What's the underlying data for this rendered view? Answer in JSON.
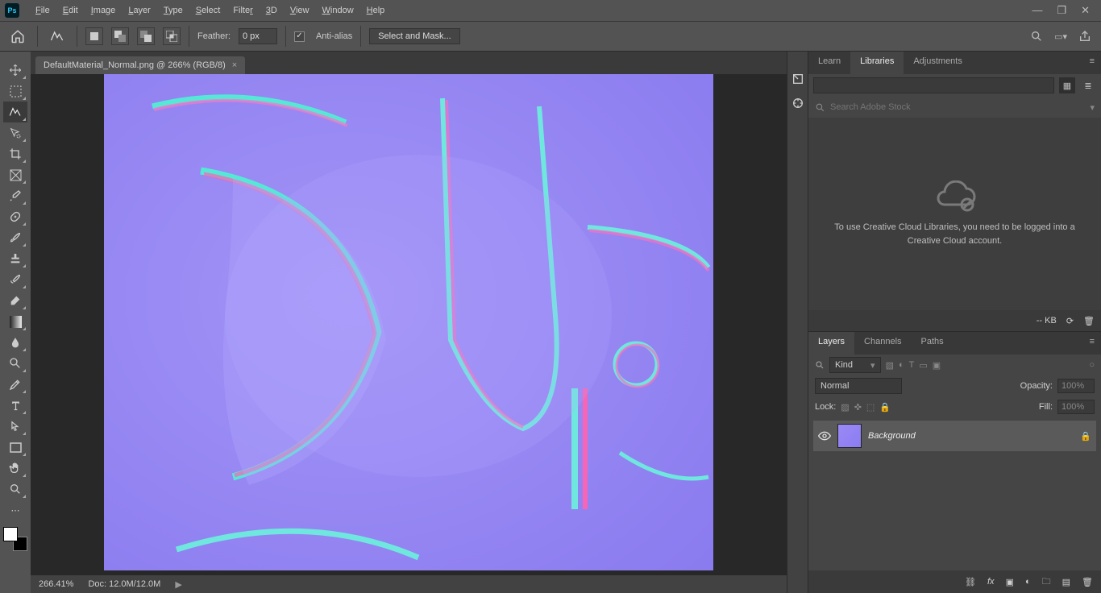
{
  "app": {
    "logo_text": "Ps"
  },
  "menu": {
    "items": [
      "File",
      "Edit",
      "Image",
      "Layer",
      "Type",
      "Select",
      "Filter",
      "3D",
      "View",
      "Window",
      "Help"
    ]
  },
  "options": {
    "feather_label": "Feather:",
    "feather_value": "0 px",
    "anti_alias_label": "Anti-alias",
    "select_mask_label": "Select and Mask..."
  },
  "document": {
    "tab_title": "DefaultMaterial_Normal.png @ 266% (RGB/8)"
  },
  "status": {
    "zoom": "266.41%",
    "doc_info": "Doc: 12.0M/12.0M"
  },
  "panels": {
    "top_tabs": [
      "Learn",
      "Libraries",
      "Adjustments"
    ],
    "search_placeholder": "Search Adobe Stock",
    "libraries_msg": "To use Creative Cloud Libraries, you need to be logged into a Creative Cloud account.",
    "lib_footer_size": "-- KB",
    "layers_tabs": [
      "Layers",
      "Channels",
      "Paths"
    ],
    "filter_kind": "Kind",
    "blend_mode": "Normal",
    "opacity_label": "Opacity:",
    "opacity_value": "100%",
    "lock_label": "Lock:",
    "fill_label": "Fill:",
    "fill_value": "100%",
    "layer0_name": "Background"
  }
}
